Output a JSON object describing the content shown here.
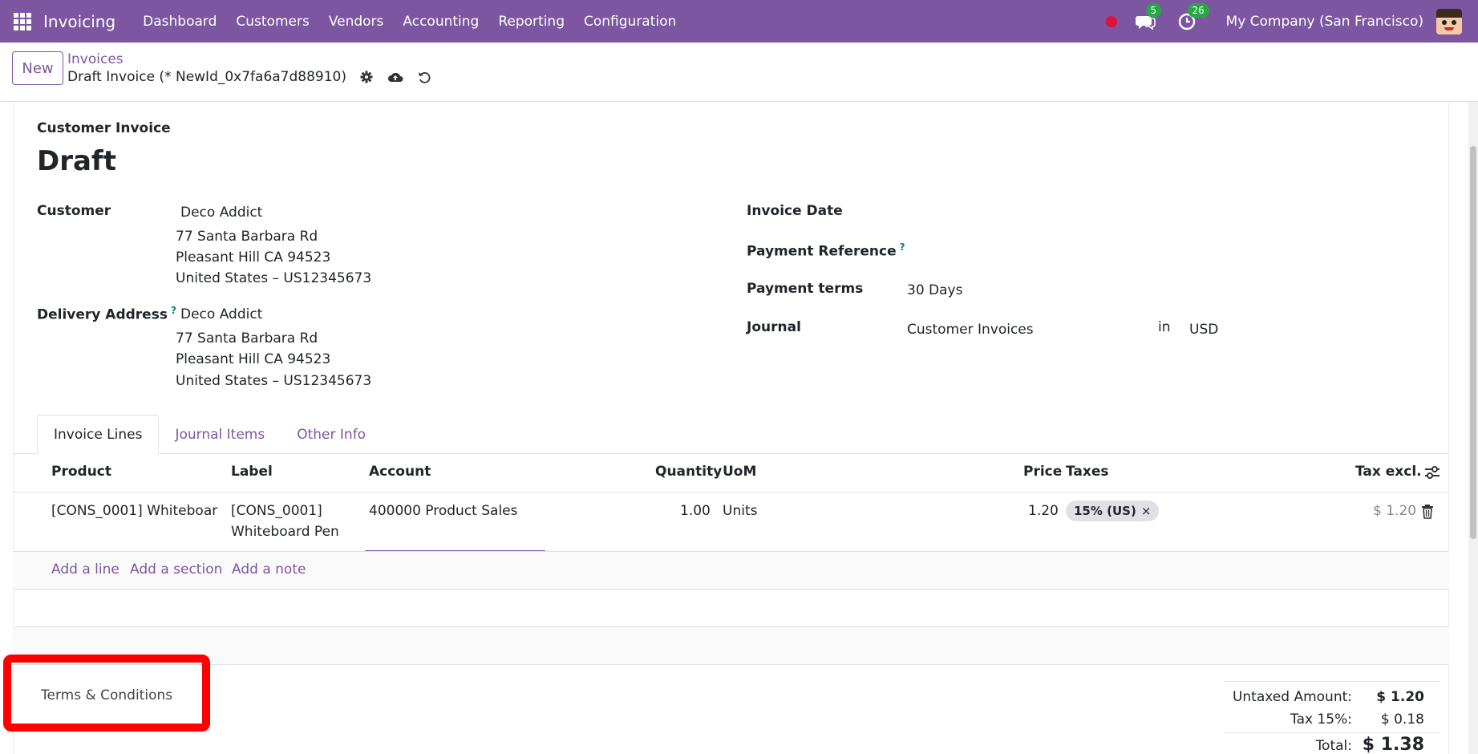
{
  "navbar": {
    "app_name": "Invoicing",
    "menu": [
      "Dashboard",
      "Customers",
      "Vendors",
      "Accounting",
      "Reporting",
      "Configuration"
    ],
    "messages_badge": "5",
    "activities_badge": "26",
    "company": "My Company (San Francisco)",
    "accent_color": "#7c56a0"
  },
  "control": {
    "new_label": "New",
    "breadcrumb": "Invoices",
    "record_title": "Draft Invoice (* NewId_0x7fa6a7d88910)"
  },
  "form": {
    "doc_type": "Customer Invoice",
    "status": "Draft",
    "customer_label": "Customer",
    "customer_name": "Deco Addict",
    "customer_address": [
      "77 Santa Barbara Rd",
      "Pleasant Hill CA 94523",
      "United States – US12345673"
    ],
    "delivery_label": "Delivery Address",
    "delivery_name": "Deco Addict",
    "delivery_address": [
      "77 Santa Barbara Rd",
      "Pleasant Hill CA 94523",
      "United States – US12345673"
    ],
    "invoice_date_label": "Invoice Date",
    "payment_ref_label": "Payment Reference",
    "payment_terms_label": "Payment terms",
    "payment_terms_value": "30 Days",
    "journal_label": "Journal",
    "journal_value": "Customer Invoices",
    "in_label": "in",
    "currency": "USD",
    "help_mark": "?"
  },
  "tabs": [
    "Invoice Lines",
    "Journal Items",
    "Other Info"
  ],
  "table": {
    "headers": {
      "product": "Product",
      "label": "Label",
      "account": "Account",
      "quantity": "Quantity",
      "uom": "UoM",
      "price": "Price",
      "taxes": "Taxes",
      "tax_excl": "Tax excl."
    },
    "rows": [
      {
        "product": "[CONS_0001] Whiteboar",
        "label_line1": "[CONS_0001]",
        "label_line2": "Whiteboard Pen",
        "account": "400000 Product Sales",
        "quantity": "1.00",
        "uom": "Units",
        "price": "1.20",
        "tax": "15% (US)",
        "tax_remove": "×",
        "subtotal": "$ 1.20"
      }
    ],
    "add_line": "Add a line",
    "add_section": "Add a section",
    "add_note": "Add a note"
  },
  "terms_label": "Terms & Conditions",
  "totals": {
    "untaxed_label": "Untaxed Amount:",
    "untaxed_value": "$ 1.20",
    "tax_label": "Tax 15%:",
    "tax_value": "$ 0.18",
    "total_label": "Total:",
    "total_value": "$ 1.38"
  }
}
